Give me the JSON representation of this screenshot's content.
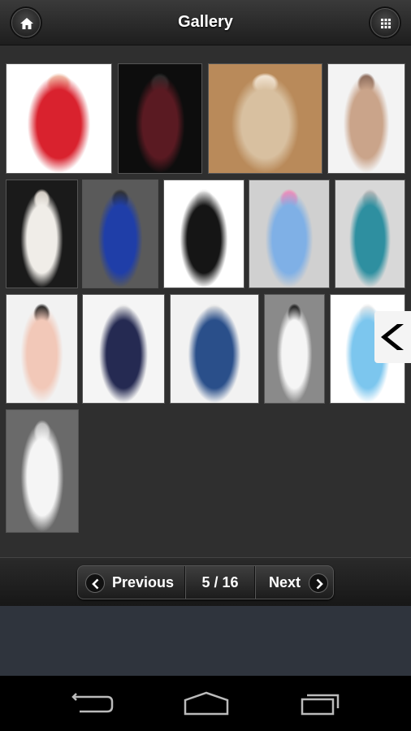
{
  "header": {
    "title": "Gallery",
    "home_icon": "home-icon",
    "grid_icon": "grid-icon"
  },
  "gallery": {
    "thumbnails": [
      {
        "name": "thumb-red-lace-dress",
        "colors": [
          "#ffffff",
          "#d9222e",
          "#f2c6b0"
        ]
      },
      {
        "name": "thumb-burgundy-dress",
        "colors": [
          "#0d0d0d",
          "#5a1a22",
          "#2a2a2a"
        ]
      },
      {
        "name": "thumb-beige-gown",
        "colors": [
          "#b98a5a",
          "#d8c0a0",
          "#f3e6d6"
        ]
      },
      {
        "name": "thumb-bronze-dress",
        "colors": [
          "#f3f3f3",
          "#caa48a",
          "#8a6a5a"
        ]
      },
      {
        "name": "thumb-white-sequin-dress",
        "colors": [
          "#1a1a1a",
          "#f0ede8",
          "#cfc8c0"
        ]
      },
      {
        "name": "thumb-blue-tulle-dress",
        "colors": [
          "#5a5a5a",
          "#1f3ea8",
          "#303030"
        ]
      },
      {
        "name": "thumb-black-hilo-dress",
        "colors": [
          "#ffffff",
          "#151515",
          "#e8e8e8"
        ]
      },
      {
        "name": "thumb-blue-pink-dresses",
        "colors": [
          "#d0d0d0",
          "#7fb0e6",
          "#f28cb8"
        ]
      },
      {
        "name": "thumb-teal-hilo-dress",
        "colors": [
          "#d8d8d8",
          "#2e8fa0",
          "#b8b8b8"
        ]
      },
      {
        "name": "thumb-peach-black-dress",
        "colors": [
          "#f2f2f2",
          "#f2c8b8",
          "#202020"
        ]
      },
      {
        "name": "thumb-navy-strapless-dress",
        "colors": [
          "#f5f5f5",
          "#252a52",
          "#e6e6e6"
        ]
      },
      {
        "name": "thumb-blue-one-shoulder-dress",
        "colors": [
          "#f2f2f2",
          "#2a4f8a",
          "#e4e4e4"
        ]
      },
      {
        "name": "thumb-black-white-dress",
        "colors": [
          "#8a8a8a",
          "#f5f5f5",
          "#141414"
        ]
      },
      {
        "name": "thumb-light-blue-dress",
        "colors": [
          "#ffffff",
          "#7cc6ee",
          "#eaeaea"
        ]
      },
      {
        "name": "thumb-silver-white-dress",
        "colors": [
          "#6a6a6a",
          "#f5f5f5",
          "#b8b8b8"
        ]
      }
    ],
    "side_tab_icon": "chevron-left-icon"
  },
  "pager": {
    "previous_label": "Previous",
    "page_indicator": "5 / 16",
    "next_label": "Next",
    "previous_icon": "chevron-left-icon",
    "next_icon": "chevron-right-icon"
  },
  "navbar": {
    "back_icon": "back-icon",
    "home_icon": "home-outline-icon",
    "recents_icon": "recent-apps-icon"
  }
}
